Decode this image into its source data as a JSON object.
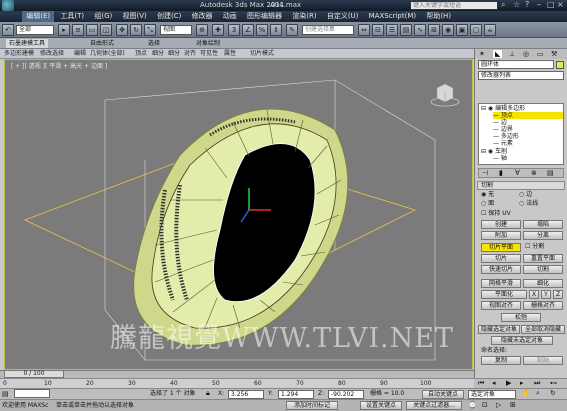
{
  "title_bar": {
    "app_title": "Autodesk 3ds Max  2011",
    "file_name": "A04.max",
    "search_placeholder": "键入关键字或短语"
  },
  "menu": {
    "items": [
      "编辑(E)",
      "工具(T)",
      "组(G)",
      "视图(V)",
      "创建(C)",
      "修改器",
      "动画",
      "图形编辑器",
      "渲染(R)",
      "自定义(U)",
      "MAXScript(M)",
      "帮助(H)"
    ]
  },
  "toolbar": {
    "filter_value": "全部",
    "refcoord_value": "视图",
    "named_selection_placeholder": "创建选择集"
  },
  "ribbon": {
    "tabs": [
      "石墨建模工具",
      "自由形式",
      "选择",
      "对象绘制"
    ],
    "sub_items": [
      "多边形建模",
      "修改选择",
      "编辑",
      "几何体(全部)",
      "顶点",
      "细分",
      "细分",
      "对齐",
      "可见性",
      "属性",
      "切片模式"
    ]
  },
  "viewport": {
    "label": "[ + ][ 透视 ][ 平滑 + 高光 + 边面 ]"
  },
  "panel": {
    "object_name": "圆环体",
    "modifier_list_label": "修改器列表",
    "tree": {
      "edit_poly": "编辑多边形",
      "vertex": "顶点",
      "edge": "边",
      "border": "边界",
      "polygon": "多边形",
      "element": "元素",
      "lathe": "车削",
      "axis": "轴"
    },
    "cut_section_label": "切割",
    "radio_none": "无",
    "radio_edge": "边",
    "radio_face": "面",
    "radio_normal": "法线",
    "preserve_uv_label": "保持 UV",
    "create_label": "创建",
    "collapse_label": "塌陷",
    "attach_label": "附加",
    "detach_label": "分离",
    "slice_plane_label": "切片平面",
    "split_label": "分割",
    "slice_label": "切片",
    "reset_plane_label": "重置平面",
    "quickslice_label": "快速切片",
    "cut_label": "切割",
    "mesh_smooth_label": "网格平滑",
    "tessellate_label": "细化",
    "planarize_label": "平面化",
    "x_label": "X",
    "y_label": "Y",
    "z_label": "Z",
    "view_align_label": "视图对齐",
    "grid_align_label": "栅格对齐",
    "relax_label": "松弛",
    "hide_selected_label": "隐藏选定对象",
    "unhide_all_label": "全部取消隐藏",
    "hide_unselected_label": "隐藏未选定对象",
    "named_selections_label": "命名选择:",
    "copy_label": "复制",
    "paste_label": "粘贴"
  },
  "timeline": {
    "frame_display": "0 / 100",
    "ticks": [
      "0",
      "10",
      "20",
      "30",
      "40",
      "50",
      "60",
      "70",
      "80",
      "90",
      "100"
    ]
  },
  "status": {
    "selected_text": "选择了 1 个 对象",
    "x_label": "X:",
    "x_value": "3.256",
    "y_label": "Y:",
    "y_value": "1.294",
    "z_label": "Z:",
    "z_value": "-90.202",
    "grid_text": "栅格 = 10.0",
    "auto_key_label": "自动关键点",
    "selected_object_dd": "选定对象",
    "welcome_text": "欢迎使用  MAXSc",
    "prompt_text": "单击或单击并拖动以选择对象",
    "add_time_tag": "添加时间标记",
    "set_key_label": "设置关键点",
    "key_filters_label": "关键点过滤器..."
  },
  "watermark": {
    "text": "騰龍視覺WWW.TLVI.NET"
  },
  "colors": {
    "titlebar": "#1a2434",
    "viewport_bg": "#7b7b7b",
    "ring_face": "#e3ecaa",
    "selection_yellow": "#ffff00"
  }
}
